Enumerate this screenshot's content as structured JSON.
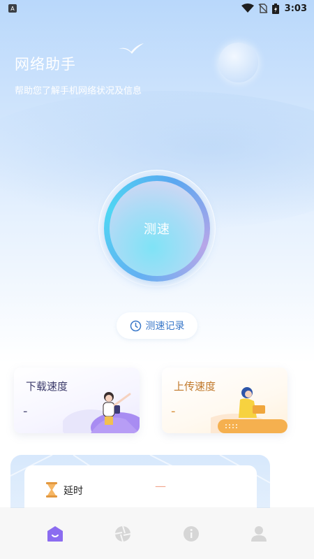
{
  "status_bar": {
    "time": "3:03",
    "notification_icon": "app-notification-icon",
    "icons": [
      "wifi-icon",
      "no-sim-icon",
      "battery-charging-icon"
    ]
  },
  "header": {
    "title": "网络助手",
    "subtitle": "帮助您了解手机网络状况及信息"
  },
  "speed_test": {
    "button_label": "测速"
  },
  "history": {
    "label": "测速记录",
    "icon": "clock-icon"
  },
  "cards": {
    "download": {
      "label": "下载速度",
      "value": "-"
    },
    "upload": {
      "label": "上传速度",
      "value": "-"
    }
  },
  "latency": {
    "label": "延时",
    "value": "—",
    "icon": "hourglass-icon"
  },
  "tabbar": {
    "tabs": [
      {
        "name": "home",
        "icon": "home-icon",
        "active": true
      },
      {
        "name": "discover",
        "icon": "aperture-icon",
        "active": false
      },
      {
        "name": "info",
        "icon": "info-icon",
        "active": false
      },
      {
        "name": "profile",
        "icon": "user-icon",
        "active": false
      }
    ]
  },
  "colors": {
    "accent": "#3a78c9",
    "active_tab": "#8b6cf0",
    "inactive_tab": "#d6d6d6",
    "download_label": "#3b3a6a",
    "upload_label": "#c0782a"
  }
}
